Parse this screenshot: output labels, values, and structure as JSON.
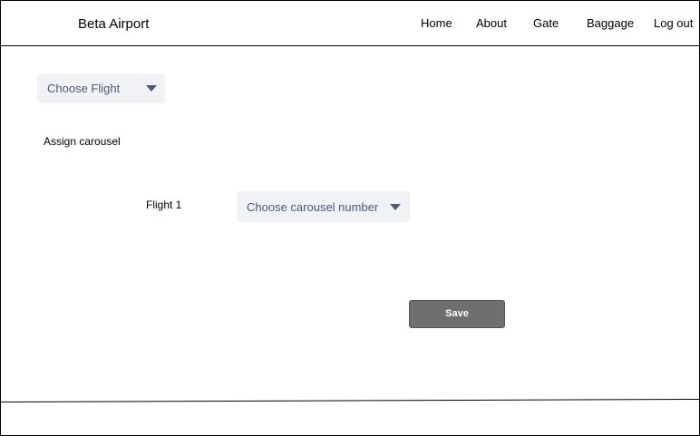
{
  "header": {
    "brand": "Beta Airport",
    "nav": [
      "Home",
      "About",
      "Gate",
      "Baggage",
      "Log out"
    ]
  },
  "flight_select": {
    "value": "Choose Flight"
  },
  "assign": {
    "title": "Assign carousel",
    "flight_label": "Flight 1",
    "carousel_select": {
      "value": "Choose carousel number"
    }
  },
  "save_button": {
    "label": "Save"
  },
  "colors": {
    "select_bg": "#f1f2f5",
    "select_text": "#4a5a78",
    "button_bg": "#6f6f6f"
  },
  "icons": [
    "caret-down-icon"
  ]
}
